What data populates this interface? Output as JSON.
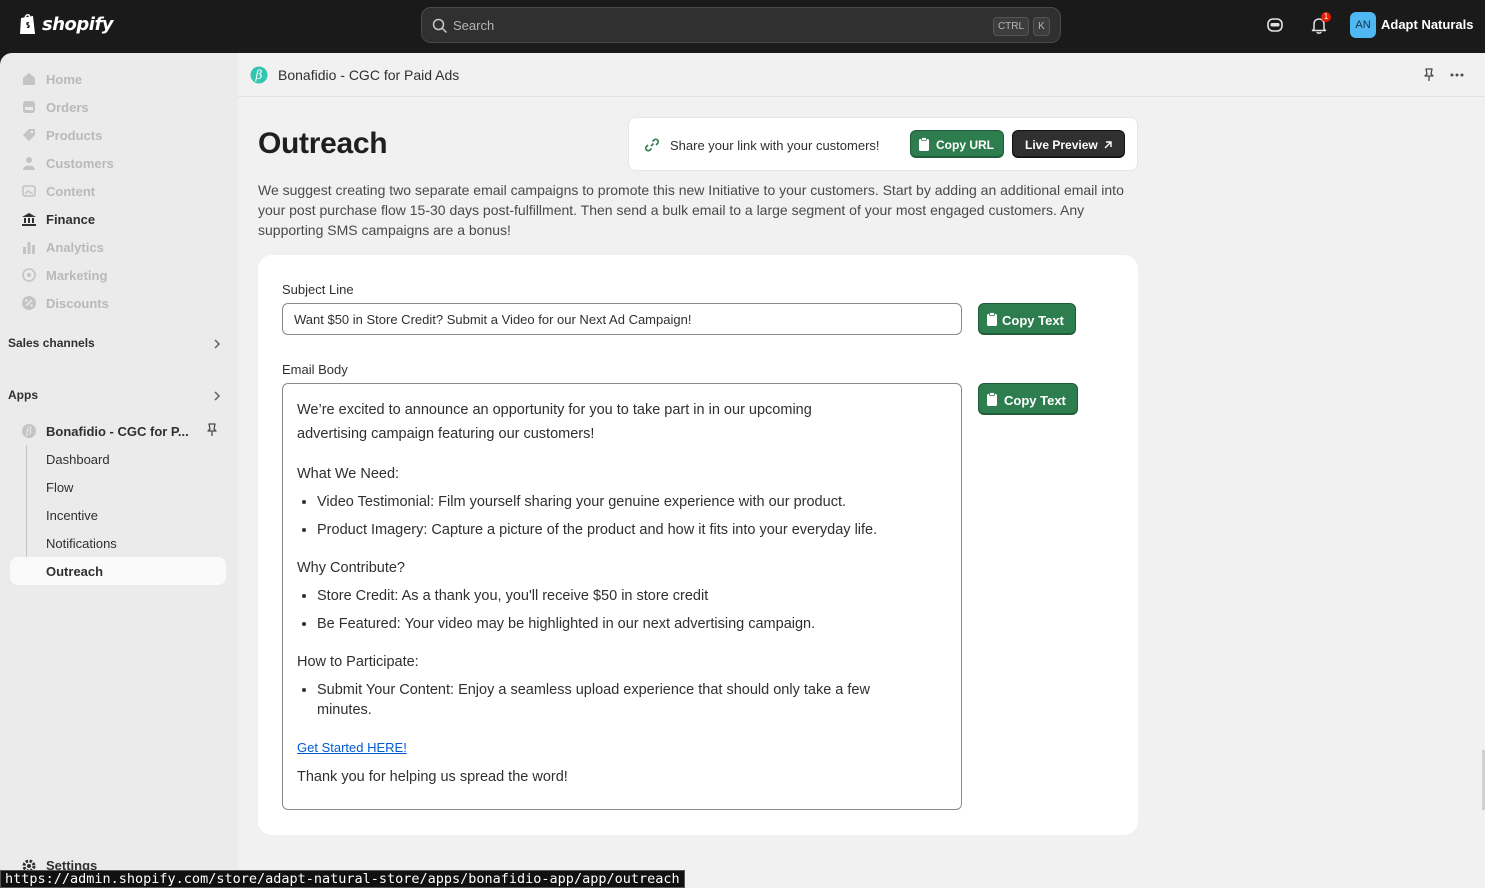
{
  "topbar": {
    "brand": "shopify",
    "search_placeholder": "Search",
    "shortcut_ctrl": "CTRL",
    "shortcut_k": "K",
    "notification_count": "1",
    "avatar_initials": "AN",
    "store_name": "Adapt Naturals"
  },
  "sidebar": {
    "items": [
      {
        "label": "Home",
        "icon": "home-icon"
      },
      {
        "label": "Orders",
        "icon": "orders-icon"
      },
      {
        "label": "Products",
        "icon": "tag-icon"
      },
      {
        "label": "Customers",
        "icon": "person-icon"
      },
      {
        "label": "Content",
        "icon": "image-icon"
      },
      {
        "label": "Finance",
        "icon": "bank-icon"
      },
      {
        "label": "Analytics",
        "icon": "bar-chart-icon"
      },
      {
        "label": "Marketing",
        "icon": "target-icon"
      },
      {
        "label": "Discounts",
        "icon": "discount-icon"
      }
    ],
    "sales_channels": "Sales channels",
    "apps": "Apps",
    "app_name": "Bonafidio - CGC for P...",
    "app_subitems": [
      "Dashboard",
      "Flow",
      "Incentive",
      "Notifications",
      "Outreach"
    ],
    "settings": "Settings"
  },
  "appbar": {
    "title": "Bonafidio - CGC for Paid Ads"
  },
  "page": {
    "title": "Outreach",
    "share_text": "Share your link with your customers!",
    "copy_url": "Copy URL",
    "live_preview": "Live Preview",
    "intro": "We suggest creating two separate email campaigns to promote this new Initiative to your customers. Start by adding an additional email into your post purchase flow 15-30 days post-fulfillment. Then send a bulk email to a large segment of your most engaged customers. Any supporting SMS campaigns are a bonus!",
    "subject_label": "Subject Line",
    "subject_value": "Want $50 in Store Credit? Submit a Video for our Next Ad Campaign!",
    "copy_text": "Copy Text",
    "body_label": "Email Body",
    "email": {
      "intro": "We’re excited to announce an opportunity for you to take part in in our upcoming advertising campaign featuring our customers!",
      "need_heading": "What We Need:",
      "need_items": [
        "Video Testimonial:  Film yourself sharing your genuine experience with our product.",
        "Product Imagery: Capture a picture of the product and how it fits into your everyday life."
      ],
      "why_heading": "Why Contribute?",
      "why_items": [
        "Store Credit: As a thank you, you'll receive $50 in store credit",
        "Be Featured: Your video may be highlighted in our next advertising campaign."
      ],
      "how_heading": "How to Participate:",
      "how_items": [
        "Submit Your Content: Enjoy a seamless upload experience that should only take a few minutes."
      ],
      "link": "Get Started HERE!",
      "thanks": "Thank you for helping us spread the word!"
    }
  },
  "statusbar": {
    "url": "https://admin.shopify.com/store/adapt-natural-store/apps/bonafidio-app/app/outreach"
  },
  "colors": {
    "primary_green": "#2e7d4f",
    "topbar": "#1a1a1a",
    "link": "#005bd3"
  }
}
